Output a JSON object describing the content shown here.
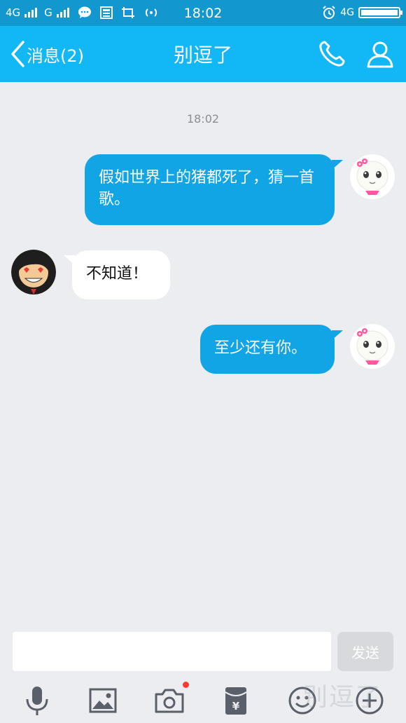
{
  "status_bar": {
    "net1": "4G",
    "net2": "G",
    "time": "18:02",
    "net3": "4G"
  },
  "header": {
    "back_label": "消息(2)",
    "title": "别逗了"
  },
  "chat": {
    "timestamp": "18:02",
    "messages": [
      {
        "direction": "outgoing",
        "text": "假如世界上的猪都死了，猜一首歌。"
      },
      {
        "direction": "incoming",
        "text": "不知道！"
      },
      {
        "direction": "outgoing",
        "text": "至少还有你。"
      }
    ]
  },
  "composer": {
    "input_value": "",
    "send_label": "发送"
  },
  "toolbar": {
    "items": [
      "mic-icon",
      "image-icon",
      "camera-icon",
      "red-packet-icon",
      "emoji-icon",
      "plus-icon"
    ]
  },
  "watermark": "别逗了",
  "colors": {
    "header": "#12b7f5",
    "outgoing_bubble": "#12a5e6",
    "incoming_bubble": "#ffffff",
    "background": "#ebedf0"
  }
}
